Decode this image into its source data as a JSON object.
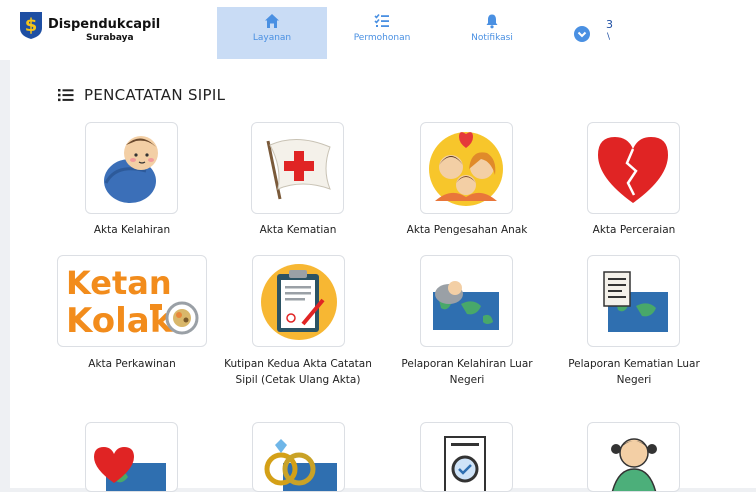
{
  "header": {
    "brand": "Dispendukcapil",
    "brand_sub": "Surabaya",
    "nav": [
      {
        "label": "Layanan",
        "icon": "home-icon",
        "active": true
      },
      {
        "label": "Permohonan",
        "icon": "list-check-icon",
        "active": false
      },
      {
        "label": "Notifikasi",
        "icon": "bell-icon",
        "active": false
      }
    ],
    "user_initial": "3"
  },
  "section": {
    "title": "PENCATATAN SIPIL"
  },
  "services": [
    {
      "label": "Akta Kelahiran",
      "icon": "baby-icon"
    },
    {
      "label": "Akta Kematian",
      "icon": "red-cross-flag-icon"
    },
    {
      "label": "Akta Pengesahan Anak",
      "icon": "family-icon"
    },
    {
      "label": "Akta Perceraian",
      "icon": "broken-heart-icon"
    },
    {
      "label": "Akta Perkawinan",
      "icon": "ketan-kolak-logo"
    },
    {
      "label": "Kutipan Kedua Akta Catatan Sipil (Cetak Ulang Akta)",
      "icon": "clipboard-document-icon"
    },
    {
      "label": "Pelaporan Kelahiran Luar Negeri",
      "icon": "baby-world-map-icon"
    },
    {
      "label": "Pelaporan Kematian Luar Negeri",
      "icon": "document-world-map-icon"
    }
  ],
  "logo_text": {
    "ketan": "Ketan",
    "kolak": "Kolak"
  },
  "colors": {
    "accent": "#4a90e2",
    "active_tab_bg": "#c9dcf5",
    "red": "#e02424"
  }
}
